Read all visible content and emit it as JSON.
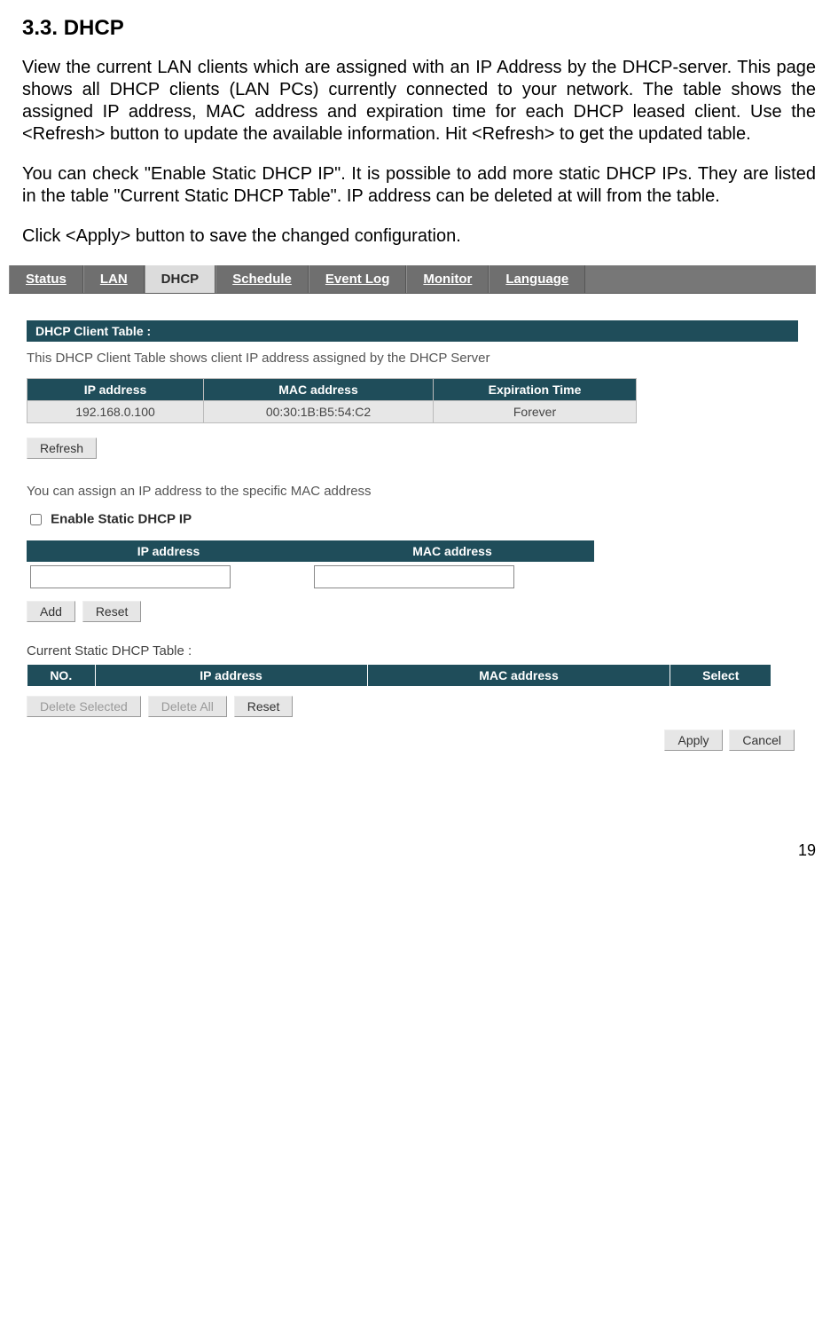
{
  "heading": "3.3. DHCP",
  "para1": "View the current LAN clients which are assigned with an IP Address by the DHCP-server. This page shows all DHCP clients (LAN PCs) currently connected to your network. The table shows the assigned IP address, MAC address and expiration time for each DHCP leased client. Use the <Refresh> button to update the available information. Hit <Refresh> to get the updated table.",
  "para2": "You can check \"Enable Static DHCP IP\". It is possible to add more static DHCP IPs. They are listed in the table \"Current Static DHCP Table\". IP address can be deleted at will from the table.",
  "para3": "Click <Apply> button to save the changed configuration.",
  "tabs": {
    "status": "Status",
    "lan": "LAN",
    "dhcp": "DHCP",
    "schedule": "Schedule",
    "eventlog": "Event Log",
    "monitor": "Monitor",
    "language": "Language"
  },
  "section_title": "DHCP Client Table :",
  "section_desc": "This DHCP Client Table shows client IP address assigned by the DHCP Server",
  "client_headers": {
    "ip": "IP address",
    "mac": "MAC address",
    "exp": "Expiration Time"
  },
  "client_row": {
    "ip": "192.168.0.100",
    "mac": "00:30:1B:B5:54:C2",
    "exp": "Forever"
  },
  "refresh": "Refresh",
  "assign_text": "You can assign an IP address to the specific MAC address",
  "enable_static": "Enable Static DHCP IP",
  "input_headers": {
    "ip": "IP address",
    "mac": "MAC address"
  },
  "add": "Add",
  "reset": "Reset",
  "static_title": "Current Static DHCP Table :",
  "static_headers": {
    "no": "NO.",
    "ip": "IP address",
    "mac": "MAC address",
    "select": "Select"
  },
  "delete_selected": "Delete Selected",
  "delete_all": "Delete All",
  "apply": "Apply",
  "cancel": "Cancel",
  "page_num": "19"
}
